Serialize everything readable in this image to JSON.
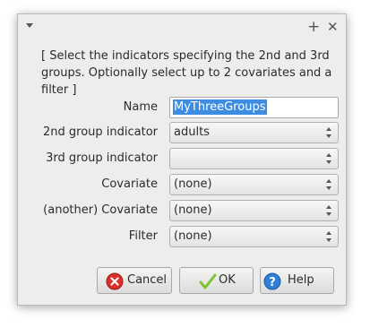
{
  "window": {
    "menu_icon": "chevron-down-icon",
    "maximize_icon": "plus-icon",
    "close_icon": "close-icon",
    "maximize_glyph": "+",
    "close_glyph": "✕"
  },
  "instructions": "[ Select the indicators specifying the 2nd and 3rd groups. Optionally select up to 2 covariates and a filter ]",
  "form": {
    "name_label": "Name",
    "name_value": "MyThreeGroups",
    "group2_label": "2nd group indicator",
    "group2_value": "adults",
    "group3_label": "3rd group indicator",
    "group3_value": "",
    "covariate_label": "Covariate",
    "covariate_value": "(none)",
    "covariate2_label": "(another) Covariate",
    "covariate2_value": "(none)",
    "filter_label": "Filter",
    "filter_value": "(none)"
  },
  "buttons": {
    "cancel_label": "Cancel",
    "cancel_icon": "cancel-icon",
    "ok_label": "OK",
    "ok_icon": "checkmark-icon",
    "help_label": "Help",
    "help_icon": "help-icon"
  },
  "colors": {
    "selection": "#3d8ee2",
    "cancel_red": "#d9302b",
    "ok_green": "#7fc32f",
    "help_blue": "#2f7fd8"
  }
}
